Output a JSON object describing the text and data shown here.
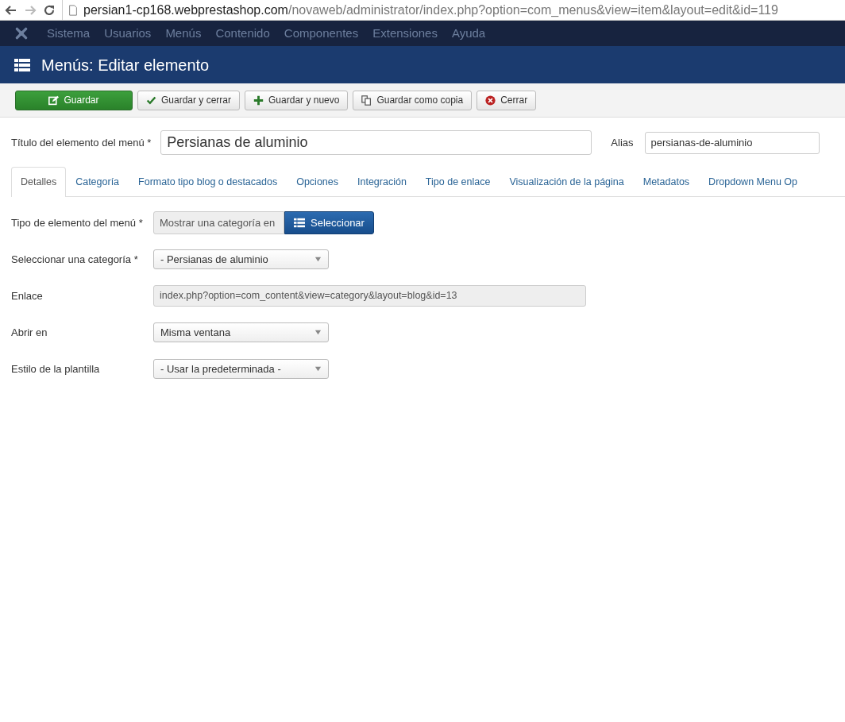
{
  "browser": {
    "url_host": "persian1-cp168.webprestashop.com",
    "url_path": "/novaweb/administrator/index.php?option=com_menus&view=item&layout=edit&id=119"
  },
  "menubar": [
    "Sistema",
    "Usuarios",
    "Menús",
    "Contenido",
    "Componentes",
    "Extensiones",
    "Ayuda"
  ],
  "header": {
    "title": "Menús: Editar elemento"
  },
  "toolbar": [
    {
      "label": "Guardar",
      "kind": "edit",
      "primary": true
    },
    {
      "label": "Guardar y cerrar",
      "kind": "check",
      "primary": false
    },
    {
      "label": "Guardar y nuevo",
      "kind": "plus",
      "primary": false
    },
    {
      "label": "Guardar como copia",
      "kind": "copy",
      "primary": false
    },
    {
      "label": "Cerrar",
      "kind": "close",
      "primary": false
    }
  ],
  "title_field": {
    "label": "Título del elemento del menú *",
    "value": "Persianas de aluminio"
  },
  "alias_field": {
    "label": "Alias",
    "value": "persianas-de-aluminio"
  },
  "tabs": [
    {
      "label": "Detalles",
      "selected": true
    },
    {
      "label": "Categoría",
      "selected": false
    },
    {
      "label": "Formato tipo blog o destacados",
      "selected": false
    },
    {
      "label": "Opciones",
      "selected": false
    },
    {
      "label": "Integración",
      "selected": false
    },
    {
      "label": "Tipo de enlace",
      "selected": false
    },
    {
      "label": "Visualización de la página",
      "selected": false
    },
    {
      "label": "Metadatos",
      "selected": false
    },
    {
      "label": "Dropdown Menu Op",
      "selected": false
    }
  ],
  "fields": [
    {
      "kind": "picker",
      "label": "Tipo de elemento del menú *",
      "value": "Mostrar una categoría en",
      "button": "Seleccionar"
    },
    {
      "kind": "select",
      "label": "Seleccionar una categoría *",
      "value": "- Persianas de aluminio"
    },
    {
      "kind": "readonly",
      "label": "Enlace",
      "value": "index.php?option=com_content&view=category&layout=blog&id=13"
    },
    {
      "kind": "select",
      "label": "Abrir en",
      "value": "Misma ventana"
    },
    {
      "kind": "select",
      "label": "Estilo de la plantilla",
      "value": "- Usar la predeterminada -"
    }
  ]
}
